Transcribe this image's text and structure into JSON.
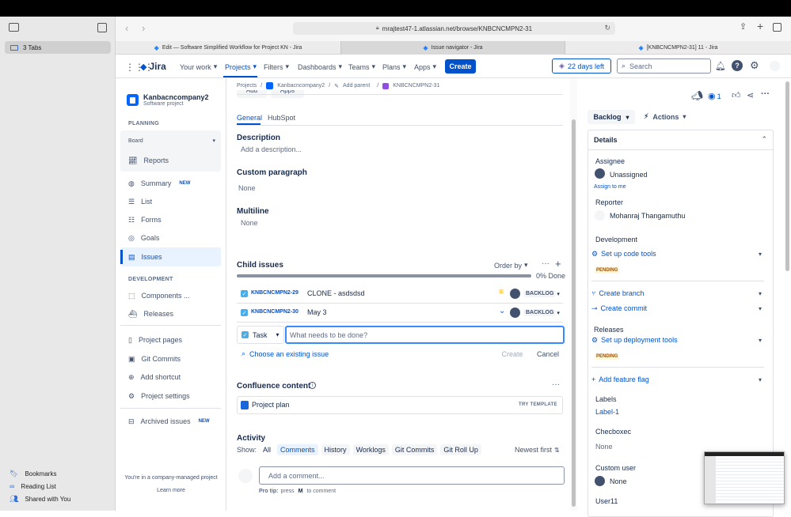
{
  "browser": {
    "sidebar_tabs_label": "3 Tabs",
    "url": "mrajtest47-1.atlassian.net/browse/KNBCNCMPN2-31",
    "tabs": [
      {
        "label": "Edit — Software Simplified Workflow for Project KN - Jira"
      },
      {
        "label": "Issue navigator - Jira"
      },
      {
        "label": "[KNBCNCMPN2-31] 11 - Jira"
      }
    ],
    "bottom_links": [
      "Bookmarks",
      "Reading List",
      "Shared with You"
    ]
  },
  "nav": {
    "logo": "Jira",
    "items": [
      "Your work",
      "Projects",
      "Filters",
      "Dashboards",
      "Teams",
      "Plans",
      "Apps"
    ],
    "create": "Create",
    "trial": "22 days left",
    "search_placeholder": "Search"
  },
  "project": {
    "name": "Kanbacncompany2",
    "type": "Software project",
    "planning_heading": "PLANNING",
    "board_label": "Board",
    "reports": "Reports",
    "summary": "Summary",
    "new_badge": "NEW",
    "list": "List",
    "forms": "Forms",
    "goals": "Goals",
    "issues": "Issues",
    "development_heading": "DEVELOPMENT",
    "components": "Components ...",
    "releases": "Releases",
    "project_pages": "Project pages",
    "git_commits": "Git Commits",
    "add_shortcut": "Add shortcut",
    "project_settings": "Project settings",
    "archived": "Archived issues",
    "managed_text": "You're in a company-managed project",
    "learn_more": "Learn more"
  },
  "breadcrumb": {
    "projects": "Projects",
    "sep": "/",
    "project": "Kanbacncompany2",
    "add_parent": "Add parent",
    "issue": "KNBCNCMPN2-31"
  },
  "issue": {
    "partial_buttons": [
      "Add",
      "Apps"
    ],
    "tabs": [
      "General",
      "HubSpot"
    ],
    "description_heading": "Description",
    "description_placeholder": "Add a description...",
    "custom_paragraph_heading": "Custom paragraph",
    "custom_paragraph_value": "None",
    "multiline_heading": "Multiline",
    "multiline_value": "None",
    "child_heading": "Child issues",
    "order_by": "Order by",
    "progress_text": "0% Done",
    "progress_fraction": 0,
    "children": [
      {
        "key": "KNBCNCMPN2-29",
        "summary": "CLONE - asdsdsd",
        "status": "BACKLOG"
      },
      {
        "key": "KNBCNCMPN2-30",
        "summary": "May 3",
        "status": "BACKLOG"
      }
    ],
    "new_child": {
      "type": "Task",
      "placeholder": "What needs to be done?",
      "create": "Create",
      "cancel": "Cancel"
    },
    "choose_existing": "Choose an existing issue",
    "confluence_heading": "Confluence content",
    "confluence_item": "Project plan",
    "try_template": "TRY TEMPLATE",
    "activity_heading": "Activity",
    "show_label": "Show:",
    "activity_filters": [
      "All",
      "Comments",
      "History",
      "Worklogs",
      "Git Commits",
      "Git Roll Up"
    ],
    "sort": "Newest first",
    "comment_placeholder": "Add a comment...",
    "protip_prefix": "Pro tip:",
    "protip_press": "press",
    "protip_key": "M",
    "protip_suffix": "to comment"
  },
  "details": {
    "watch_count": "1",
    "status": "Backlog",
    "actions": "Actions",
    "heading": "Details",
    "assignee_label": "Assignee",
    "assignee_value": "Unassigned",
    "assign_to_me": "Assign to me",
    "reporter_label": "Reporter",
    "reporter_value": "Mohanraj Thangamuthu",
    "development_label": "Development",
    "setup_code": "Set up code tools",
    "pending": "PENDING",
    "create_branch": "Create branch",
    "create_commit": "Create commit",
    "releases_label": "Releases",
    "setup_deploy": "Set up deployment tools",
    "add_flag": "Add feature flag",
    "labels_label": "Labels",
    "labels_value": "Label-1",
    "checkbox_label": "Checboxec",
    "checkbox_value": "None",
    "custom_user_label": "Custom user",
    "custom_user_value": "None",
    "user11_label": "User11"
  },
  "colors": {
    "brand": "#0052cc",
    "link": "#0052cc",
    "pending_bg": "#fff7d6",
    "pending_fg": "#974f0c"
  }
}
